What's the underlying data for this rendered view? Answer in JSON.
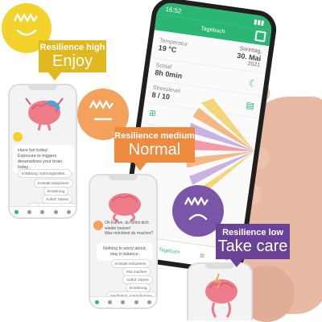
{
  "big_phone": {
    "time": "16:52",
    "title": "Tagebuch",
    "temperature_label": "Temperatur",
    "temperature_value": "19 °C",
    "weekday": "Sonntag,",
    "date": "30. Mai",
    "year": "2021",
    "sleep_label": "Schlaf",
    "sleep_value": "8h 0min",
    "stress_label": "Stresslevel",
    "stress_value": "8 / 10",
    "nav_label": "Tagebuch"
  },
  "phone_high": {
    "message_1": "Have fun today!",
    "message_2": "Exposure to triggers desensitizes your brain today.",
    "options": [
      "Erklärung: Nahrungsmittel...",
      "Kontakt reduzieren",
      "Ernährung",
      "Aufruf: Stress",
      "Meditation: Atemübungen"
    ]
  },
  "phone_medium": {
    "message_1": "Oh Kaffee, du fühlst dich wieder besser!",
    "message_2": "Was möchtest du machen?",
    "message_3": "Nothing to worry about, stay in balance.",
    "options": [
      "Kontakt reduzieren",
      "Mut machen",
      "Aufruf: Stress",
      "Ernährung",
      "Meditation: Atemübungen"
    ]
  },
  "bubbles": {
    "high": {
      "status": "Resilience high",
      "mood": "Enjoy",
      "color": "#f3d22b",
      "label_color": "#e0b81f"
    },
    "medium": {
      "status": "Resilience medium",
      "mood": "Normal",
      "color": "#f4a15b",
      "label_color": "#ee8a3d"
    },
    "low": {
      "status": "Resilience low",
      "mood": "Take care",
      "color": "#7b55a8",
      "label_color": "#6a4399"
    }
  },
  "icons": [
    "happy-brain-logo-icon",
    "neutral-brain-logo-icon",
    "sad-brain-logo-icon",
    "brain-mascot-icon",
    "calendar-icon",
    "thermometer-icon",
    "moon-icon",
    "stress-icon"
  ]
}
